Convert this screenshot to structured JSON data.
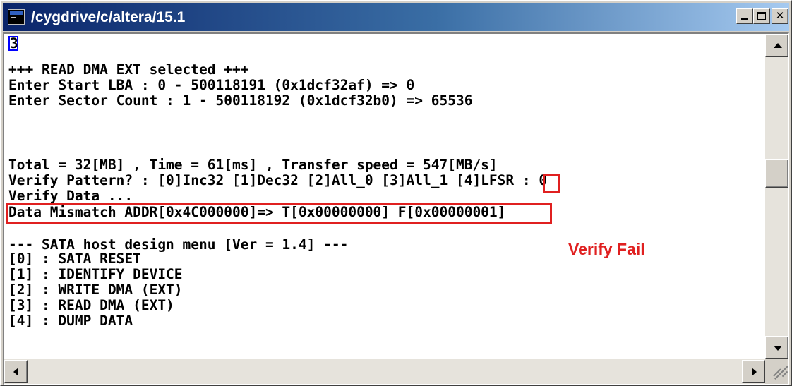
{
  "window": {
    "title": "/cygdrive/c/altera/15.1",
    "icons": [
      "terminal-window-icon",
      "minimize-icon",
      "maximize-icon",
      "close-icon"
    ]
  },
  "terminal": {
    "cursor_char": "3",
    "lines": [
      "+++ READ DMA EXT selected +++",
      "Enter Start LBA : 0 - 500118191 (0x1dcf32af) => 0",
      "Enter Sector Count : 1 - 500118192 (0x1dcf32b0) => 65536",
      "",
      "",
      "Total = 32[MB] , Time = 61[ms] , Transfer speed = 547[MB/s]",
      "Verify Pattern? : [0]Inc32 [1]Dec32 [2]All_0 [3]All_1 [4]LFSR : 0",
      "Verify Data ...",
      "Data Mismatch ADDR[0x4C000000]=> T[0x00000000] F[0x00000001]",
      "",
      "--- SATA host design menu [Ver = 1.4] ---",
      "[0] : SATA RESET",
      "[1] : IDENTIFY DEVICE",
      "[2] : WRITE DMA (EXT)",
      "[3] : READ DMA (EXT)",
      "[4] : DUMP DATA"
    ]
  },
  "annotation": {
    "label": "Verify Fail",
    "color": "#e02020"
  },
  "colors": {
    "title_gradient_start": "#0a246a",
    "title_gradient_end": "#a6caf0",
    "cursor_outline": "#0000ff"
  }
}
